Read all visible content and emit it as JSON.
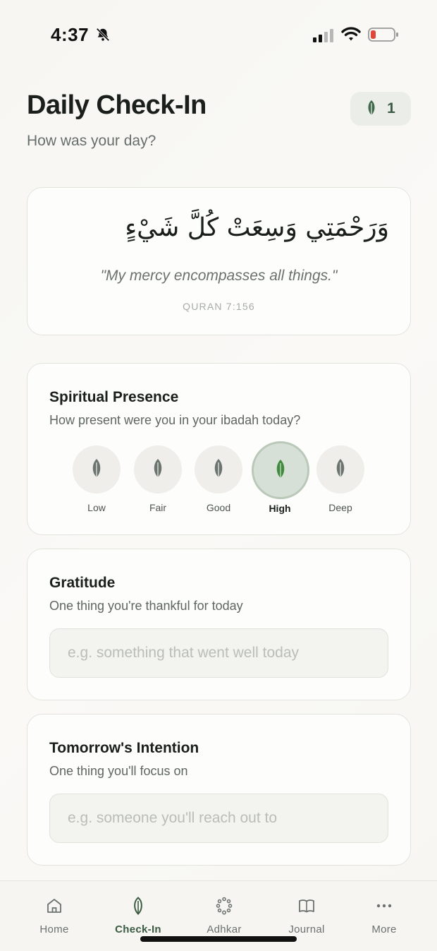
{
  "status_bar": {
    "time": "4:37"
  },
  "header": {
    "title": "Daily Check-In",
    "subtitle": "How was your day?",
    "streak_count": "1"
  },
  "quote": {
    "arabic": "وَرَحْمَتِي وَسِعَتْ كُلَّ شَيْءٍ",
    "translation": "\"My mercy encompasses all things.\"",
    "reference": "QURAN 7:156"
  },
  "presence": {
    "title": "Spiritual Presence",
    "subtitle": "How present were you in your ibadah today?",
    "levels": [
      {
        "label": "Low",
        "selected": false
      },
      {
        "label": "Fair",
        "selected": false
      },
      {
        "label": "Good",
        "selected": false
      },
      {
        "label": "High",
        "selected": true
      },
      {
        "label": "Deep",
        "selected": false
      }
    ]
  },
  "gratitude": {
    "title": "Gratitude",
    "subtitle": "One thing you're thankful for today",
    "placeholder": "e.g. something that went well today",
    "value": ""
  },
  "intention": {
    "title": "Tomorrow's Intention",
    "subtitle": "One thing you'll focus on",
    "placeholder": "e.g. someone you'll reach out to",
    "value": ""
  },
  "tabs": [
    {
      "label": "Home",
      "icon": "home-icon",
      "active": false
    },
    {
      "label": "Check-In",
      "icon": "leaf-icon",
      "active": true
    },
    {
      "label": "Adhkar",
      "icon": "prayer-beads-icon",
      "active": false
    },
    {
      "label": "Journal",
      "icon": "book-icon",
      "active": false
    },
    {
      "label": "More",
      "icon": "more-icon",
      "active": false
    }
  ],
  "colors": {
    "accent": "#3a5a42",
    "leaf_selected": "#3f8a3c",
    "leaf_default": "#6b746e",
    "battery_low": "#e0473b"
  }
}
